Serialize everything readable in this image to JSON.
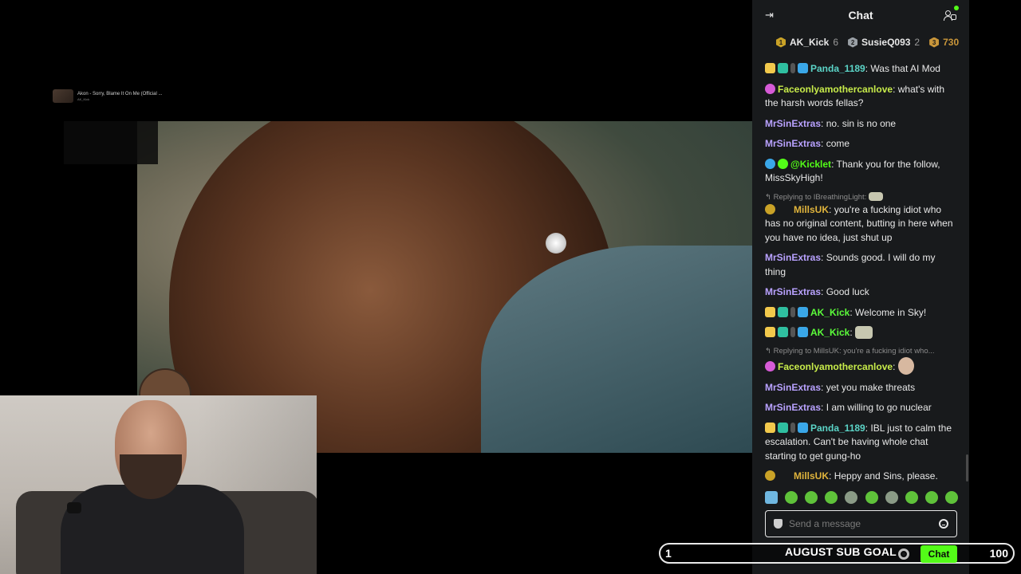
{
  "video": {
    "title_line1": "Akon - Sorry, Blame It On Me (Official ...",
    "title_line2": "AK_Kick"
  },
  "chat": {
    "title": "Chat",
    "top_gifters": [
      {
        "name": "AK_Kick",
        "count": "6",
        "badge": "1",
        "color": "#c9a227"
      },
      {
        "name": "SusieQ093",
        "count": "2",
        "badge": "2",
        "color": "#9aa0a6"
      },
      {
        "name": "730",
        "count": "",
        "badge": "3",
        "color": "#c9963a"
      }
    ],
    "messages": [
      {
        "user": "Panda_1189",
        "color": "#5bd4c7",
        "text": "Was that AI Mod"
      },
      {
        "user": "Faceonlyamothercanlove",
        "color": "#c8ec4a",
        "text": "what's with the harsh words fellas?"
      },
      {
        "user": "MrSinExtras",
        "color": "#b9a2ff",
        "text": "no. sin is no one"
      },
      {
        "user": "MrSinExtras",
        "color": "#b9a2ff",
        "text": "come"
      },
      {
        "user": "@Kicklet",
        "color": "#53fc18",
        "text": "Thank you for the follow, MissSkyHigh!"
      },
      {
        "reply": "Replying to IBreathingLight:",
        "user": "MillsUK",
        "color": "#e0b43c",
        "text": "you're a fucking idiot who has no original content, butting in here when you have no idea, just shut up"
      },
      {
        "user": "MrSinExtras",
        "color": "#b9a2ff",
        "text": "Sounds good. I will do my thing"
      },
      {
        "user": "MrSinExtras",
        "color": "#b9a2ff",
        "text": "Good luck"
      },
      {
        "user": "AK_Kick",
        "color": "#5bfc3a",
        "text": "Welcome in Sky!"
      },
      {
        "user": "AK_Kick",
        "color": "#5bfc3a",
        "text": ""
      },
      {
        "reply": "Replying to MillsUK: you're a fucking idiot who...",
        "user": "Faceonlyamothercanlove",
        "color": "#c8ec4a",
        "text": ""
      },
      {
        "user": "MrSinExtras",
        "color": "#b9a2ff",
        "text": "yet you make threats"
      },
      {
        "user": "MrSinExtras",
        "color": "#b9a2ff",
        "text": "I am willing to go nuclear"
      },
      {
        "user": "Panda_1189",
        "color": "#5bd4c7",
        "text": "IBL just to calm the escalation. Can't be having whole chat starting to get gung-ho"
      },
      {
        "user": "MillsUK",
        "color": "#e0b43c",
        "text": "Heppy and Sins, please."
      }
    ],
    "input_placeholder": "Send a message",
    "send_button": "Chat"
  },
  "goal": {
    "title": "AUGUST SUB GOAL",
    "current": "1",
    "target": "100"
  }
}
